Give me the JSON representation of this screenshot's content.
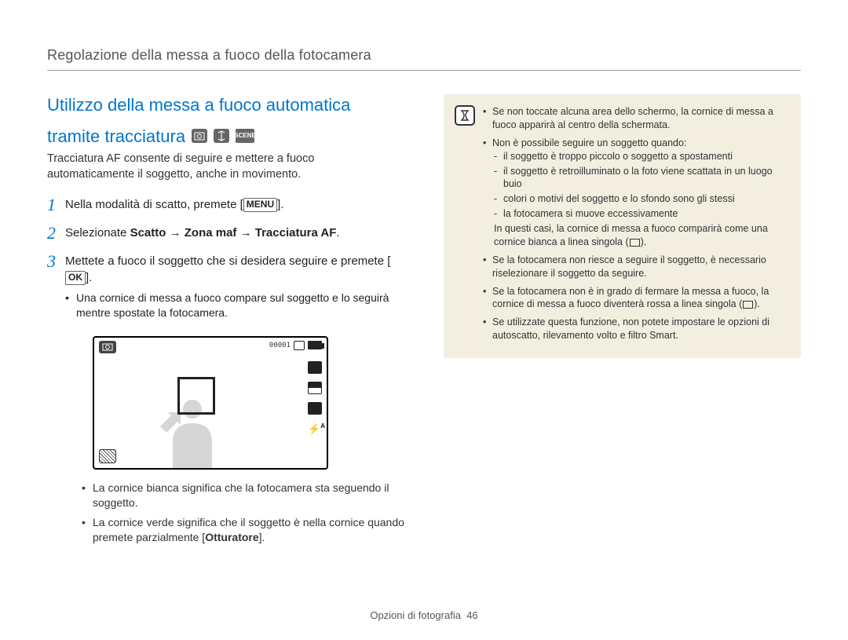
{
  "header": {
    "title": "Regolazione della messa a fuoco della fotocamera"
  },
  "section": {
    "heading_line1": "Utilizzo della messa a fuoco automatica",
    "heading_line2": "tramite tracciatura",
    "mode_icon_p": "P",
    "mode_icon_scene": "SCENE",
    "intro": "Tracciatura AF consente di seguire e mettere a fuoco automaticamente il soggetto, anche in movimento."
  },
  "steps": {
    "s1": {
      "num": "1",
      "text_a": "Nella modalità di scatto, premete [",
      "key": "MENU",
      "text_b": "]."
    },
    "s2": {
      "num": "2",
      "text_a": "Selezionate ",
      "bold": "Scatto → Zona maf → Tracciatura AF",
      "text_b": "."
    },
    "s3": {
      "num": "3",
      "text_a": "Mettete a fuoco il soggetto che si desidera seguire e premete [",
      "key": "OK",
      "text_b": "].",
      "bullets": {
        "b1": "Una cornice di messa a fuoco compare sul soggetto e lo seguirà mentre spostate la fotocamera.",
        "b2": "La cornice bianca significa che la fotocamera sta seguendo il soggetto.",
        "b3_a": "La cornice verde significa che il soggetto è nella cornice quando premete parzialmente [",
        "b3_bold": "Otturatore",
        "b3_b": "]."
      }
    }
  },
  "lcd": {
    "counter": "00001",
    "flash_label": "A"
  },
  "notes": {
    "n1": "Se non toccate alcuna area dello schermo, la cornice di messa a fuoco apparirà al centro della schermata.",
    "n2": "Non è possibile seguire un soggetto quando:",
    "n2_sub": {
      "a": "il soggetto è troppo piccolo o soggetto a spostamenti",
      "b": "il soggetto è retroilluminato o la foto viene scattata in un luogo buio",
      "c": "colori o motivi del soggetto e lo sfondo sono gli stessi",
      "d": "la fotocamera si muove eccessivamente"
    },
    "n2_tail_a": "In questi casi, la cornice di messa a fuoco comparirà come una cornice bianca a linea singola (",
    "n2_tail_b": ").",
    "n3": "Se la fotocamera non riesce a seguire il soggetto, è necessario riselezionare il soggetto da seguire.",
    "n4_a": "Se la fotocamera non è in grado di fermare la messa a fuoco, la cornice di messa a fuoco diventerà rossa a linea singola (",
    "n4_b": ").",
    "n5": "Se utilizzate questa funzione, non potete impostare le opzioni di autoscatto, rilevamento volto e filtro Smart."
  },
  "footer": {
    "section": "Opzioni di fotografia",
    "page": "46"
  }
}
